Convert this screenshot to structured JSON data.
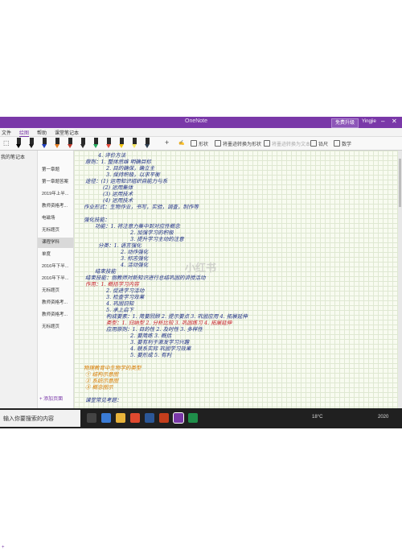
{
  "window": {
    "title": "OneNote",
    "upgrade_label": "免费升级",
    "user": "Yingjie"
  },
  "tabs": [
    "文件",
    "绘图",
    "帮助",
    "课堂笔记本"
  ],
  "toolbar": {
    "pens": [
      "#000000",
      "#1a1a1a",
      "#1f3fbf",
      "#e67e22",
      "#c0392b",
      "#2b2b2b",
      "#27ae60",
      "#e74c3c",
      "#f1c40f",
      "#f5e663",
      "#2c3e50"
    ],
    "items": [
      "形状",
      "将墨迹转换为形状",
      "将墨迹转换为文本",
      "铅尺",
      "数学"
    ]
  },
  "sidebar": {
    "notebook": "我的笔记本",
    "add_section": "+",
    "add_page": "添加页面"
  },
  "pages": [
    "第一章题",
    "第一章题答案",
    "2019年上半...",
    "教师资格考...",
    "电磁场",
    "无标题页",
    "课程学科",
    "单度",
    "2016年下半...",
    "2016年下半...",
    "无标题页",
    "教师资格考...",
    "教师资格考...",
    "无标题页"
  ],
  "selected_page": 6,
  "notes": [
    {
      "t": "4. 评价方法",
      "c": "blue"
    },
    {
      "t": "原则：1. 整体思维 明确目标",
      "c": "blue"
    },
    {
      "t": "2. 目的确保，确立主",
      "c": "blue"
    },
    {
      "t": "3. 保持积极，以求平衡",
      "c": "blue"
    },
    {
      "t": "途径：(1) 运用知识组织自能力与系",
      "c": "blue"
    },
    {
      "t": "(2) 运用集体",
      "c": "blue"
    },
    {
      "t": "(3) 运用技术",
      "c": "blue"
    },
    {
      "t": "(4) 运用技术",
      "c": "blue"
    },
    {
      "t": "作业形式：生物作业，书写，实验，调查，制作等",
      "c": "blue"
    },
    {
      "t": "",
      "c": "blue"
    },
    {
      "t": "强化技能：",
      "c": "blue"
    },
    {
      "t": "功能：1. 将注意力集中到对应性概念",
      "c": "blue"
    },
    {
      "t": "2. 加强学习的积极",
      "c": "blue"
    },
    {
      "t": "3. 提升学习主动的注意",
      "c": "blue"
    },
    {
      "t": "分类：1. 语言强化",
      "c": "blue"
    },
    {
      "t": "2. 动作强化",
      "c": "blue"
    },
    {
      "t": "3. 标志强化",
      "c": "blue"
    },
    {
      "t": "4. 活动强化",
      "c": "blue"
    },
    {
      "t": "结束技能",
      "c": "blue"
    },
    {
      "t": "结束技能：指教师对新知识进行总结巩固的讲授活动",
      "c": "blue"
    },
    {
      "t": "作用：1. 概括学习内容",
      "c": "red"
    },
    {
      "t": "2. 促进学习活动",
      "c": "blue"
    },
    {
      "t": "3. 检查学习效果",
      "c": "blue"
    },
    {
      "t": "4. 巩固旧知",
      "c": "blue"
    },
    {
      "t": "5. 承上启下",
      "c": "blue"
    },
    {
      "t": "构成要素：1. 简要回顾 2. 提示要点 3. 巩固应用 4. 拓展延伸",
      "c": "blue"
    },
    {
      "t": "类型：1. 归纳型 2. 分析比较 3. 巩固练习 4. 拓展延伸",
      "c": "red"
    },
    {
      "t": "应用原则：1. 目的性 2. 及时性 3. 多样性",
      "c": "blue"
    },
    {
      "t": "2. 要简练 3. 概括",
      "c": "blue"
    },
    {
      "t": "3. 要有利于激发学习兴趣",
      "c": "blue"
    },
    {
      "t": "4. 联系实际 巩固学习效果",
      "c": "blue"
    },
    {
      "t": "5. 要形成  5. 有利",
      "c": "blue"
    },
    {
      "t": "",
      "c": "blue"
    },
    {
      "t": "物理教育中生物学的类型",
      "c": "orange"
    },
    {
      "t": "① 结构示意图",
      "c": "orange"
    },
    {
      "t": "② 系统示意图",
      "c": "orange"
    },
    {
      "t": "③ 概念图示",
      "c": "orange"
    },
    {
      "t": "",
      "c": "blue"
    },
    {
      "t": "课堂常见考题：",
      "c": "blue"
    }
  ],
  "watermark": "小红书",
  "taskbar": {
    "search_placeholder": "输入你要搜索的内容",
    "weather": "18°C",
    "time": "2020"
  }
}
